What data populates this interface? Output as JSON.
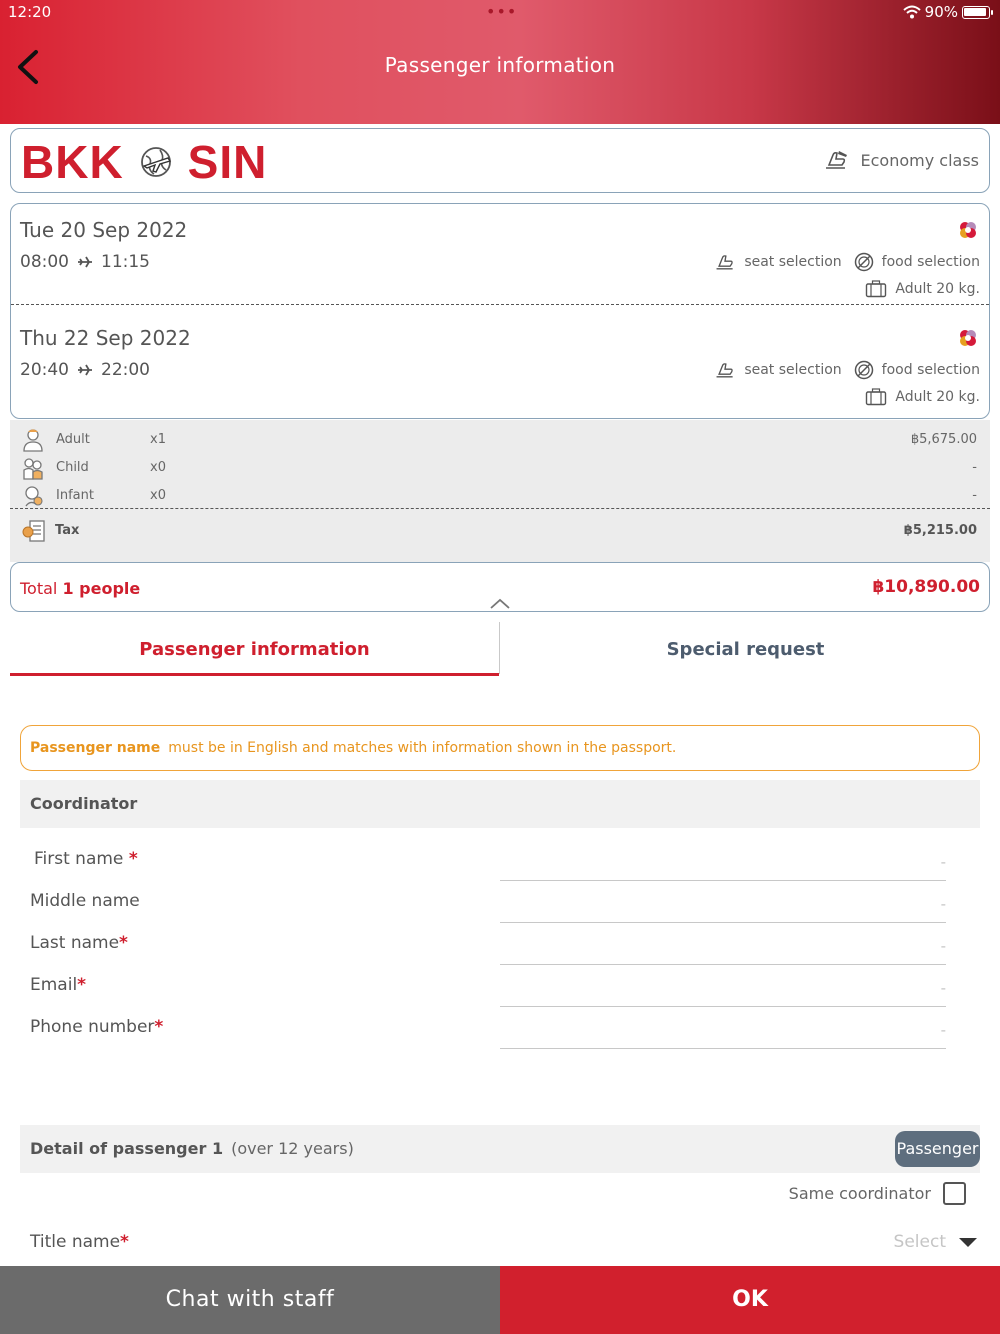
{
  "status_bar": {
    "time": "12:20",
    "dots": "•••",
    "battery": "90%"
  },
  "header": {
    "title": "Passenger information"
  },
  "route": {
    "origin": "BKK",
    "destination": "SIN",
    "cabin_class": "Economy class"
  },
  "flights": [
    {
      "date": "Tue 20 Sep 2022",
      "depart": "08:00",
      "arrive": "11:15",
      "seat": "seat selection",
      "food": "food selection",
      "baggage": "Adult 20 kg."
    },
    {
      "date": "Thu 22 Sep 2022",
      "depart": "20:40",
      "arrive": "22:00",
      "seat": "seat selection",
      "food": "food selection",
      "baggage": "Adult 20 kg."
    }
  ],
  "passengers": [
    {
      "label": "Adult",
      "count": "x1",
      "amount": "฿5,675.00"
    },
    {
      "label": "Child",
      "count": "x0",
      "amount": "-"
    },
    {
      "label": "Infant",
      "count": "x0",
      "amount": "-"
    }
  ],
  "tax": {
    "label": "Tax",
    "amount": "฿5,215.00"
  },
  "total": {
    "label": "Total",
    "people": "1 people",
    "amount": "฿10,890.00"
  },
  "tabs": {
    "passenger": "Passenger information",
    "special": "Special request"
  },
  "notice": {
    "bold": "Passenger name",
    "text": "must be in English and matches with information shown in the passport."
  },
  "coordinator": {
    "heading": "Coordinator",
    "fields": [
      {
        "label": "First name",
        "required": "*",
        "placeholder": "-"
      },
      {
        "label": "Middle name",
        "required": "",
        "placeholder": "-"
      },
      {
        "label": "Last name",
        "required": "*",
        "placeholder": "-"
      },
      {
        "label": "Email",
        "required": "*",
        "placeholder": "-"
      },
      {
        "label": "Phone number",
        "required": "*",
        "placeholder": "-"
      }
    ]
  },
  "passenger_detail": {
    "heading": "Detail of passenger 1",
    "sub": "(over 12 years)",
    "button": "Passenger",
    "same_coordinator": "Same coordinator",
    "title_label": "Title name",
    "title_required": "*",
    "title_placeholder": "Select"
  },
  "bottom": {
    "chat": "Chat with staff",
    "ok": "OK"
  },
  "colors": {
    "brand_red": "#cf1f2e",
    "notice_orange": "#f0a43a",
    "border_blue": "#8aa3b8",
    "button_gray": "#5e6e7e"
  }
}
